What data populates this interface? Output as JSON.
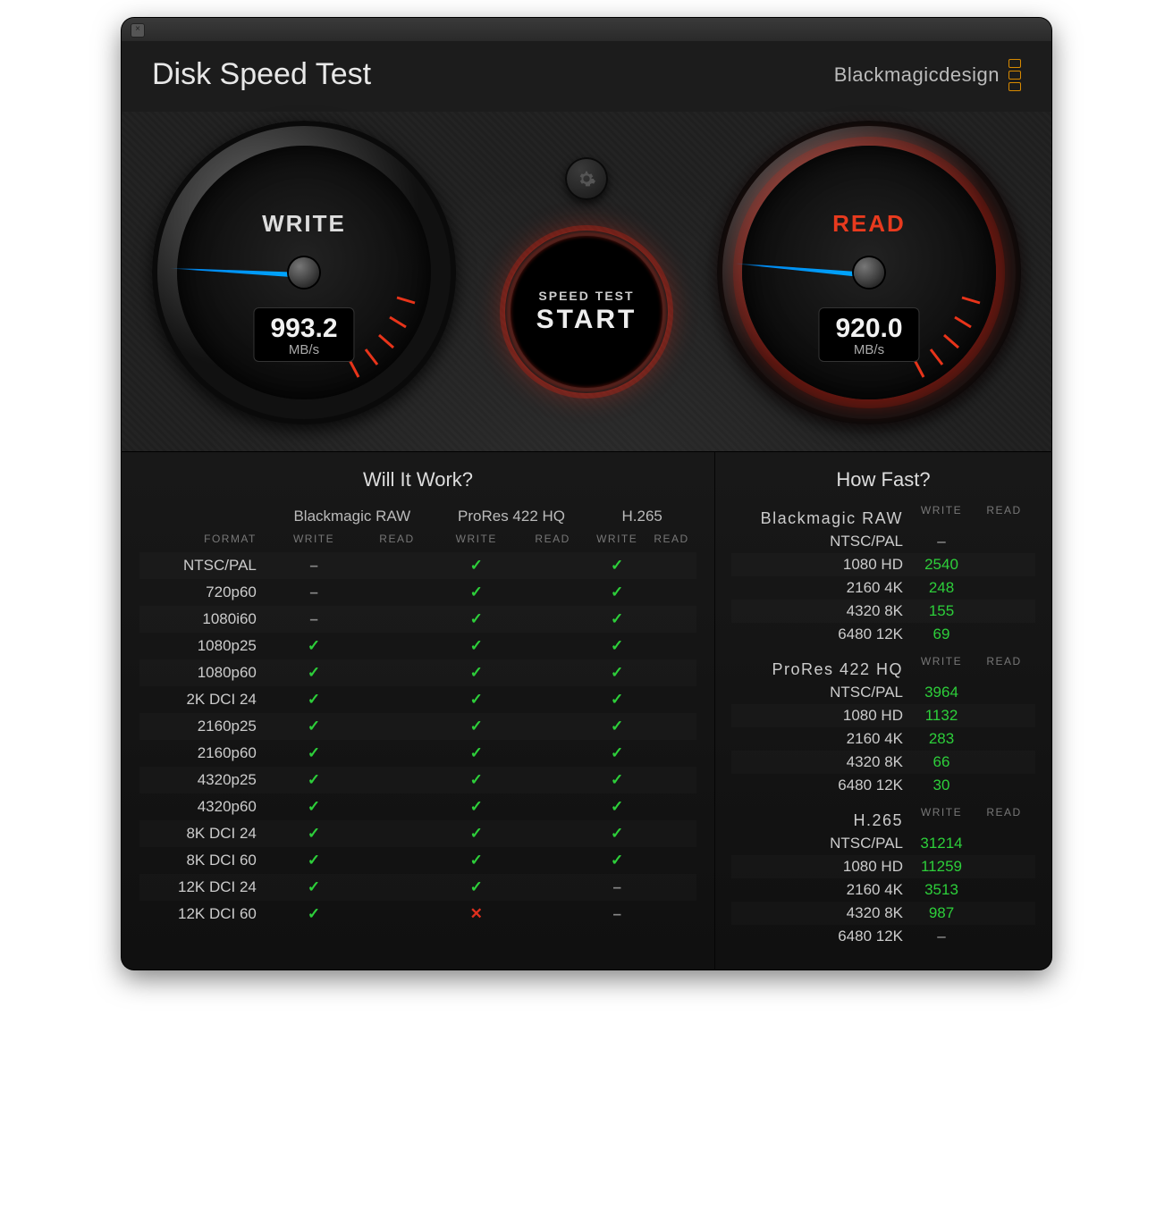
{
  "app_title": "Disk Speed Test",
  "brand": "Blackmagicdesign",
  "settings_icon": "gear",
  "start_button": {
    "line1": "SPEED TEST",
    "line2": "START"
  },
  "gauges": {
    "write": {
      "label": "WRITE",
      "value": "993.2",
      "unit": "MB/s"
    },
    "read": {
      "label": "READ",
      "value": "920.0",
      "unit": "MB/s"
    }
  },
  "will_it_work": {
    "title": "Will It Work?",
    "codec_columns": [
      "Blackmagic RAW",
      "ProRes 422 HQ",
      "H.265"
    ],
    "sub_columns": [
      "WRITE",
      "READ"
    ],
    "format_header": "FORMAT",
    "rows": [
      {
        "format": "NTSC/PAL",
        "cells": [
          "dash",
          "",
          "check",
          "",
          "check",
          ""
        ]
      },
      {
        "format": "720p60",
        "cells": [
          "dash",
          "",
          "check",
          "",
          "check",
          ""
        ]
      },
      {
        "format": "1080i60",
        "cells": [
          "dash",
          "",
          "check",
          "",
          "check",
          ""
        ]
      },
      {
        "format": "1080p25",
        "cells": [
          "check",
          "",
          "check",
          "",
          "check",
          ""
        ]
      },
      {
        "format": "1080p60",
        "cells": [
          "check",
          "",
          "check",
          "",
          "check",
          ""
        ]
      },
      {
        "format": "2K DCI 24",
        "cells": [
          "check",
          "",
          "check",
          "",
          "check",
          ""
        ]
      },
      {
        "format": "2160p25",
        "cells": [
          "check",
          "",
          "check",
          "",
          "check",
          ""
        ]
      },
      {
        "format": "2160p60",
        "cells": [
          "check",
          "",
          "check",
          "",
          "check",
          ""
        ]
      },
      {
        "format": "4320p25",
        "cells": [
          "check",
          "",
          "check",
          "",
          "check",
          ""
        ]
      },
      {
        "format": "4320p60",
        "cells": [
          "check",
          "",
          "check",
          "",
          "check",
          ""
        ]
      },
      {
        "format": "8K DCI 24",
        "cells": [
          "check",
          "",
          "check",
          "",
          "check",
          ""
        ]
      },
      {
        "format": "8K DCI 60",
        "cells": [
          "check",
          "",
          "check",
          "",
          "check",
          ""
        ]
      },
      {
        "format": "12K DCI 24",
        "cells": [
          "check",
          "",
          "check",
          "",
          "dash",
          ""
        ]
      },
      {
        "format": "12K DCI 60",
        "cells": [
          "check",
          "",
          "cross",
          "",
          "dash",
          ""
        ]
      }
    ]
  },
  "how_fast": {
    "title": "How Fast?",
    "columns": [
      "WRITE",
      "READ"
    ],
    "groups": [
      {
        "name": "Blackmagic RAW",
        "rows": [
          {
            "label": "NTSC/PAL",
            "write": "–",
            "read": ""
          },
          {
            "label": "1080 HD",
            "write": "2540",
            "read": ""
          },
          {
            "label": "2160 4K",
            "write": "248",
            "read": ""
          },
          {
            "label": "4320 8K",
            "write": "155",
            "read": ""
          },
          {
            "label": "6480 12K",
            "write": "69",
            "read": ""
          }
        ]
      },
      {
        "name": "ProRes 422 HQ",
        "rows": [
          {
            "label": "NTSC/PAL",
            "write": "3964",
            "read": ""
          },
          {
            "label": "1080 HD",
            "write": "1132",
            "read": ""
          },
          {
            "label": "2160 4K",
            "write": "283",
            "read": ""
          },
          {
            "label": "4320 8K",
            "write": "66",
            "read": ""
          },
          {
            "label": "6480 12K",
            "write": "30",
            "read": ""
          }
        ]
      },
      {
        "name": "H.265",
        "rows": [
          {
            "label": "NTSC/PAL",
            "write": "31214",
            "read": ""
          },
          {
            "label": "1080 HD",
            "write": "11259",
            "read": ""
          },
          {
            "label": "2160 4K",
            "write": "3513",
            "read": ""
          },
          {
            "label": "4320 8K",
            "write": "987",
            "read": ""
          },
          {
            "label": "6480 12K",
            "write": "–",
            "read": ""
          }
        ]
      }
    ]
  }
}
